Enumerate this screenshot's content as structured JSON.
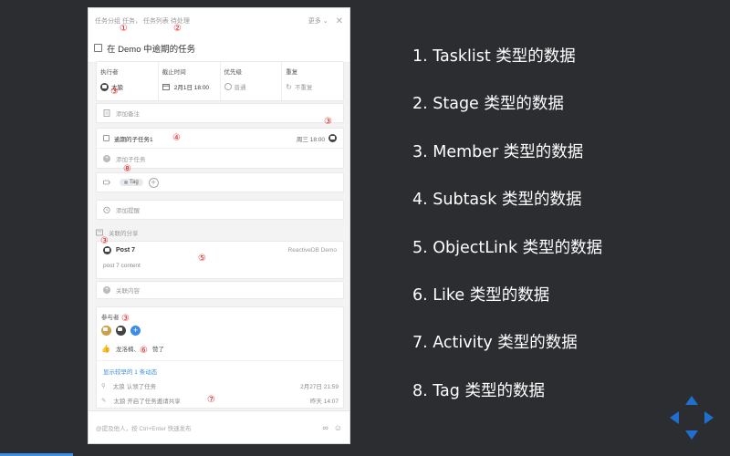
{
  "task_panel": {
    "breadcrumb": {
      "group_prefix": "任务分组",
      "group_name": "任务",
      "list_prefix": "任务列表",
      "list_name": "待处理"
    },
    "more_label": "更多",
    "task_title": "在 Demo 中逾期的任务",
    "meta": {
      "assignee_label": "执行者",
      "assignee_value": "太狼",
      "due_label": "截止时间",
      "due_value": "2月1日 18:00",
      "priority_label": "优先级",
      "priority_value": "普通",
      "repeat_label": "重复",
      "repeat_value": "不重复"
    },
    "add_note": "添加备注",
    "subtask": {
      "name": "逾期的子任务1",
      "due": "周三 18:00",
      "add_label": "添加子任务"
    },
    "tag_label": "Tag",
    "add_reminder": "添加提醒",
    "shares_label": "关联的分享",
    "post": {
      "title": "Post 7",
      "source": "ReactiveDB Demo",
      "content": "post 7 content"
    },
    "link_content": "关联内容",
    "participants_label": "参与者",
    "like_text": "龙洛楠、",
    "like_suffix": "赞了",
    "show_more": "显示较早的 1 条动态",
    "activities": [
      {
        "text": "太狼 认领了任务",
        "time": "2月27日 21:59"
      },
      {
        "text": "太狼 开启了任务邀请共享",
        "time": "昨天 14:07"
      }
    ],
    "comment_placeholder": "@提及他人，按 Ctrl+Enter 快速发布"
  },
  "annotations": {
    "n1": "①",
    "n2": "②",
    "n3": "③",
    "n4": "④",
    "n5": "⑤",
    "n6": "⑥",
    "n7": "⑦",
    "n8": "⑧"
  },
  "slide_list": [
    "1. Tasklist 类型的数据",
    "2. Stage 类型的数据",
    "3. Member 类型的数据",
    "4. Subtask 类型的数据",
    "5. ObjectLink 类型的数据",
    "6. Like 类型的数据",
    "7. Activity 类型的数据",
    "8. Tag 类型的数据"
  ],
  "colors": {
    "background": "#2b2d31",
    "accent": "#3a8ee6",
    "annotation": "#e02020"
  },
  "icons": [
    "close-icon",
    "calendar-icon",
    "priority-circle-icon",
    "repeat-icon",
    "note-icon",
    "plus-icon",
    "tag-icon",
    "alarm-icon",
    "share-icon",
    "thumbs-up-icon",
    "user-icon",
    "pencil-icon",
    "emoji-icon",
    "nav-arrows-icon"
  ]
}
